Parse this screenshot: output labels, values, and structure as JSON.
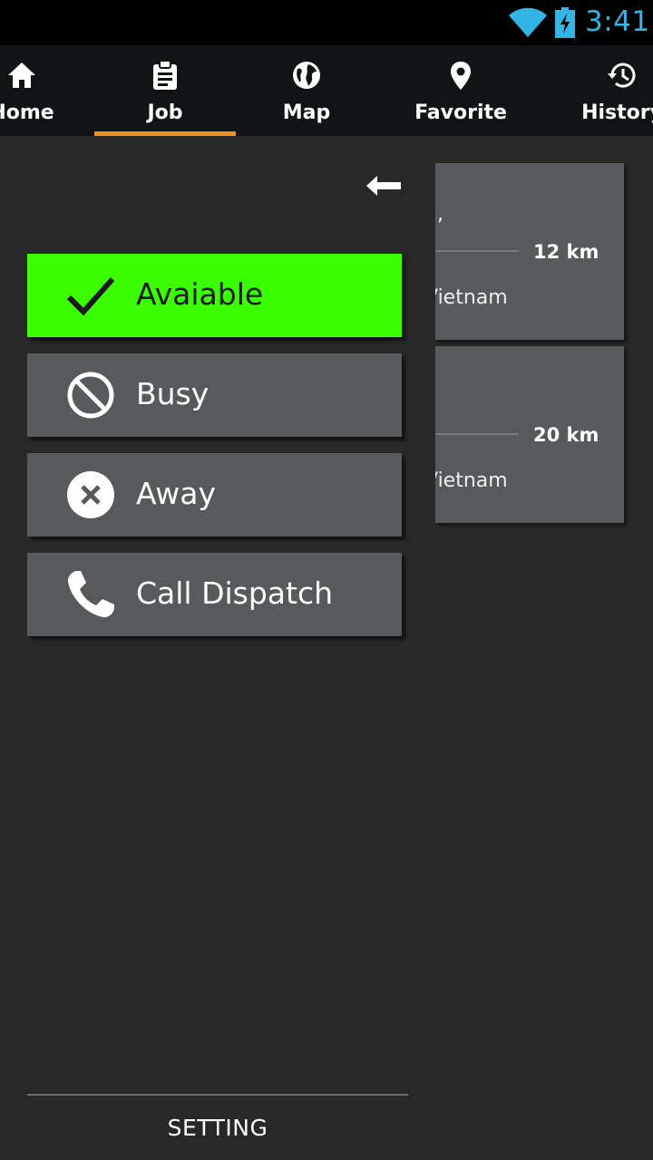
{
  "status_bar": {
    "time": "3:41",
    "icons": [
      "wifi-icon",
      "battery-charging-icon"
    ],
    "accent_color": "#33b5e5"
  },
  "tabs": [
    {
      "label": "Home",
      "icon": "home-icon",
      "active": false
    },
    {
      "label": "Job",
      "icon": "clipboard-icon",
      "active": true
    },
    {
      "label": "Map",
      "icon": "globe-icon",
      "active": false
    },
    {
      "label": "Favorite",
      "icon": "location-pin-icon",
      "active": false
    },
    {
      "label": "History",
      "icon": "history-icon",
      "active": false
    }
  ],
  "tab_indicator_color": "#f0901c",
  "jobs": [
    {
      "address_fragment": "n,",
      "distance": "12 km",
      "country_fragment": "Vietnam"
    },
    {
      "address_fragment": "",
      "distance": "20 km",
      "country_fragment": "Vietnam"
    }
  ],
  "drawer": {
    "back_icon": "back-arrow-icon",
    "status_options": [
      {
        "label": "Avaiable",
        "icon": "checkmark-icon",
        "selected": true
      },
      {
        "label": "Busy",
        "icon": "block-icon",
        "selected": false
      },
      {
        "label": "Away",
        "icon": "close-circle-icon",
        "selected": false
      },
      {
        "label": "Call Dispatch",
        "icon": "phone-icon",
        "selected": false
      }
    ],
    "selected_color": "#3bff00",
    "setting_label": "SETTING"
  }
}
